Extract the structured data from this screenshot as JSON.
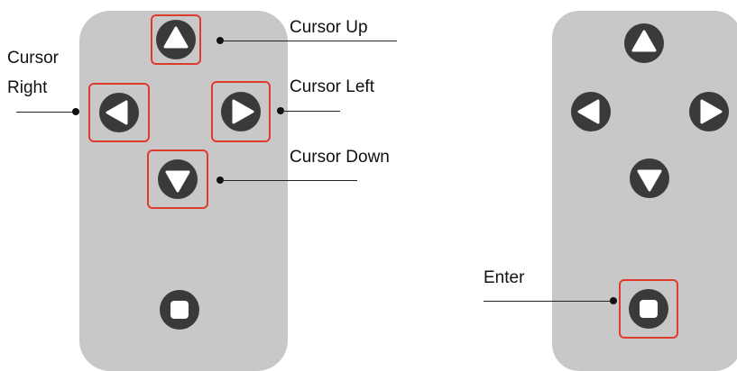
{
  "colors": {
    "panel": "#c8c8c8",
    "button_fill": "#3a3a3a",
    "button_glyph": "#ffffff",
    "highlight": "#e03a2e"
  },
  "left_panel": {
    "buttons": [
      {
        "id": "up",
        "icon": "triangle-up-icon",
        "highlighted": true
      },
      {
        "id": "left-side",
        "icon": "triangle-left-icon",
        "highlighted": true
      },
      {
        "id": "right-side",
        "icon": "triangle-right-icon",
        "highlighted": true
      },
      {
        "id": "down",
        "icon": "triangle-down-icon",
        "highlighted": true
      },
      {
        "id": "enter",
        "icon": "square-icon",
        "highlighted": false
      }
    ],
    "labels": {
      "cursor_up": "Cursor Up",
      "cursor_right_line1": "Cursor",
      "cursor_right_line2": "Right",
      "cursor_left": "Cursor Left",
      "cursor_down": "Cursor Down"
    }
  },
  "right_panel": {
    "buttons": [
      {
        "id": "up",
        "icon": "triangle-up-icon",
        "highlighted": false
      },
      {
        "id": "left-side",
        "icon": "triangle-left-icon",
        "highlighted": false
      },
      {
        "id": "right-side",
        "icon": "triangle-right-icon",
        "highlighted": false
      },
      {
        "id": "down",
        "icon": "triangle-down-icon",
        "highlighted": false
      },
      {
        "id": "enter",
        "icon": "square-icon",
        "highlighted": true
      }
    ],
    "labels": {
      "enter": "Enter"
    }
  }
}
